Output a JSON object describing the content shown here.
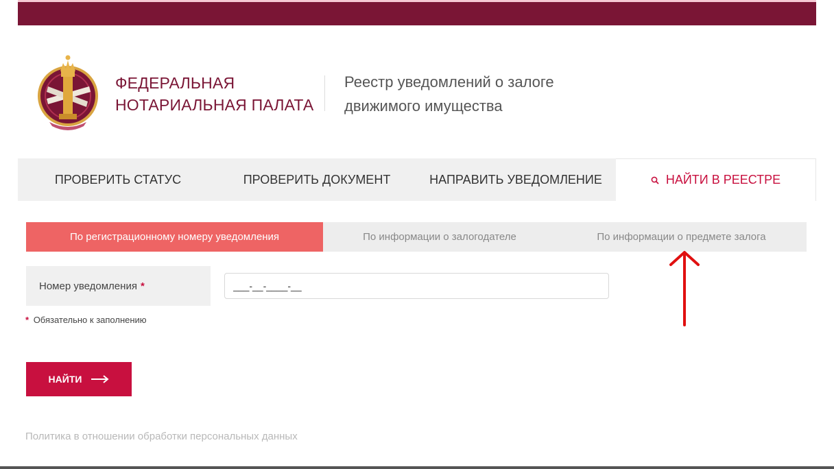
{
  "header": {
    "org_name_line1": "ФЕДЕРАЛЬНАЯ",
    "org_name_line2": "НОТАРИАЛЬНАЯ ПАЛАТА",
    "registry_title_line1": "Реестр уведомлений о залоге",
    "registry_title_line2": "движимого имущества"
  },
  "nav": {
    "items": [
      {
        "label": "ПРОВЕРИТЬ СТАТУС"
      },
      {
        "label": "ПРОВЕРИТЬ ДОКУМЕНТ"
      },
      {
        "label": "НАПРАВИТЬ УВЕДОМЛЕНИЕ"
      },
      {
        "label": "НАЙТИ В РЕЕСТРЕ",
        "active": true
      }
    ]
  },
  "search_tabs": {
    "items": [
      {
        "label": "По регистрационному номеру уведомления",
        "active": true
      },
      {
        "label": "По информации о залогодателе"
      },
      {
        "label": "По информации о предмете залога"
      }
    ]
  },
  "form": {
    "field_label": "Номер уведомления",
    "required_mark": "*",
    "input_value": "___-__-____-__",
    "required_note": "Обязательно к заполнению",
    "submit_label": "НАЙТИ"
  },
  "footer": {
    "policy_link": "Политика в отношении обработки персональных данных"
  },
  "colors": {
    "brand_dark": "#7a1535",
    "brand_accent": "#c8103f",
    "active_subtab": "#ee6464",
    "annotation_arrow": "#e01010"
  },
  "icons": {
    "nav_search": "search-icon",
    "submit_arrow": "arrow-right-icon",
    "logo": "notary-emblem"
  }
}
